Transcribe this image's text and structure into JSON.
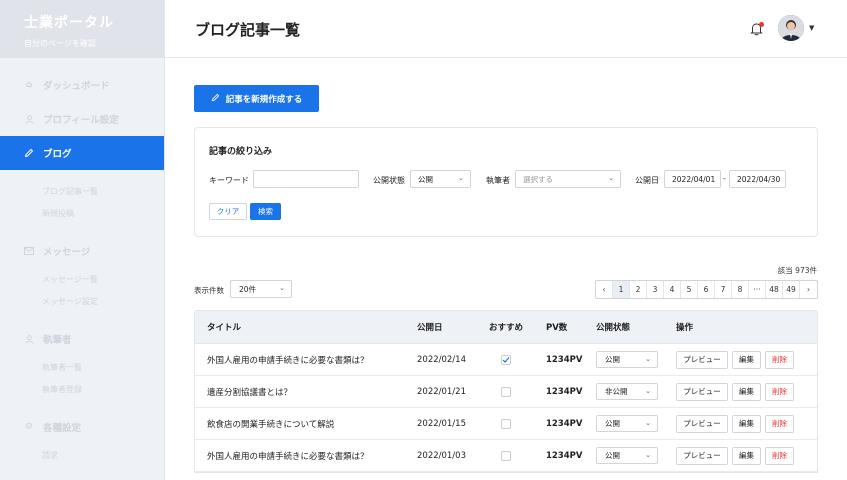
{
  "brand": {
    "title": "士業ポータル",
    "subtitle": "自分のページを確認"
  },
  "sidebar": {
    "items": [
      {
        "label": "ダッシュボード",
        "icon": "home-icon"
      },
      {
        "label": "プロフィール設定",
        "icon": "user-icon"
      },
      {
        "label": "ブログ",
        "icon": "pencil-icon",
        "active": true,
        "subs": [
          "ブログ記事一覧",
          "新規投稿"
        ]
      },
      {
        "label": "メッセージ",
        "icon": "mail-icon",
        "subs": [
          "メッセージ一覧",
          "メッセージ設定"
        ]
      },
      {
        "label": "執筆者",
        "icon": "person-icon",
        "subs": [
          "執筆者一覧",
          "執筆者登録"
        ]
      },
      {
        "label": "各種設定",
        "icon": "gear-icon",
        "subs": [
          "請求"
        ]
      }
    ]
  },
  "header": {
    "title": "ブログ記事一覧"
  },
  "main": {
    "new_button": "記事を新規作成する",
    "filter": {
      "title": "記事の絞り込み",
      "keyword_label": "キーワード",
      "keyword_value": "",
      "status_label": "公開状態",
      "status_value": "公開",
      "author_label": "執筆者",
      "author_placeholder": "選択する",
      "date_label": "公開日",
      "date_from": "2022/04/01",
      "date_sep": "-",
      "date_to": "2022/04/30",
      "clear_label": "クリア",
      "search_label": "検索"
    },
    "total": "該当 973件",
    "per_page_label": "表示件数",
    "per_page_value": "20件",
    "pagination": [
      "‹",
      "1",
      "2",
      "3",
      "4",
      "5",
      "6",
      "7",
      "8",
      "···",
      "48",
      "49",
      "›"
    ],
    "pagination_active": "1",
    "table": {
      "headers": {
        "title": "タイトル",
        "date": "公開日",
        "recommended": "おすすめ",
        "pv": "PV数",
        "status": "公開状態",
        "ops": "操作"
      },
      "ops_labels": {
        "preview": "プレビュー",
        "edit": "編集",
        "delete": "削除"
      },
      "rows": [
        {
          "title": "外国人雇用の申請手続きに必要な書類は？",
          "date": "2022/02/14",
          "recommended": true,
          "pv": "1234PV",
          "status": "公開"
        },
        {
          "title": "遺産分割協議書とは？",
          "date": "2022/01/21",
          "recommended": false,
          "pv": "1234PV",
          "status": "非公開"
        },
        {
          "title": "飲食店の開業手続きについて解説",
          "date": "2022/01/15",
          "recommended": false,
          "pv": "1234PV",
          "status": "公開"
        },
        {
          "title": "外国人雇用の申請手続きに必要な書類は？",
          "date": "2022/01/03",
          "recommended": false,
          "pv": "1234PV",
          "status": "公開"
        }
      ]
    }
  },
  "colors": {
    "accent": "#1a73e8",
    "danger": "#e53935",
    "sidebar_bg": "#eef1f6"
  }
}
